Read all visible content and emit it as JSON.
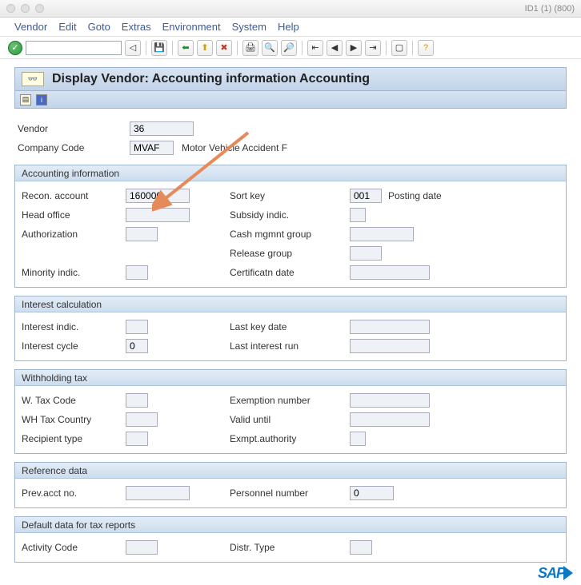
{
  "titlebar": {
    "right_text": "ID1 (1) (800)"
  },
  "menu": {
    "items": [
      "Vendor",
      "Edit",
      "Goto",
      "Extras",
      "Environment",
      "System",
      "Help"
    ]
  },
  "page": {
    "title": "Display Vendor: Accounting information Accounting"
  },
  "header": {
    "vendor_label": "Vendor",
    "vendor_value": "36",
    "company_label": "Company Code",
    "company_value": "MVAF",
    "company_desc": "Motor Vehicle Accident F"
  },
  "groups": {
    "accounting": {
      "title": "Accounting information",
      "recon_label": "Recon. account",
      "recon_value": "160000",
      "head_office_label": "Head office",
      "head_office_value": "",
      "authorization_label": "Authorization",
      "authorization_value": "",
      "minority_label": "Minority indic.",
      "minority_value": "",
      "sort_key_label": "Sort key",
      "sort_key_value": "001",
      "sort_key_desc": "Posting date",
      "subsidy_label": "Subsidy indic.",
      "subsidy_value": "",
      "cash_group_label": "Cash mgmnt group",
      "cash_group_value": "",
      "release_group_label": "Release group",
      "release_group_value": "",
      "cert_date_label": "Certificatn date",
      "cert_date_value": ""
    },
    "interest": {
      "title": "Interest calculation",
      "indic_label": "Interest indic.",
      "indic_value": "",
      "cycle_label": "Interest cycle",
      "cycle_value": "0",
      "last_key_label": "Last key date",
      "last_key_value": "",
      "last_run_label": "Last interest run",
      "last_run_value": ""
    },
    "withholding": {
      "title": "Withholding tax",
      "wtax_label": "W. Tax Code",
      "wtax_value": "",
      "country_label": "WH Tax Country",
      "country_value": "",
      "recipient_label": "Recipient type",
      "recipient_value": "",
      "exemption_label": "Exemption number",
      "exemption_value": "",
      "valid_label": "Valid  until",
      "valid_value": "",
      "authority_label": "Exmpt.authority",
      "authority_value": ""
    },
    "reference": {
      "title": "Reference data",
      "prev_label": "Prev.acct no.",
      "prev_value": "",
      "personnel_label": "Personnel number",
      "personnel_value": "0"
    },
    "default_tax": {
      "title": "Default data for tax reports",
      "activity_label": "Activity Code",
      "activity_value": "",
      "distr_label": "Distr. Type",
      "distr_value": ""
    }
  }
}
